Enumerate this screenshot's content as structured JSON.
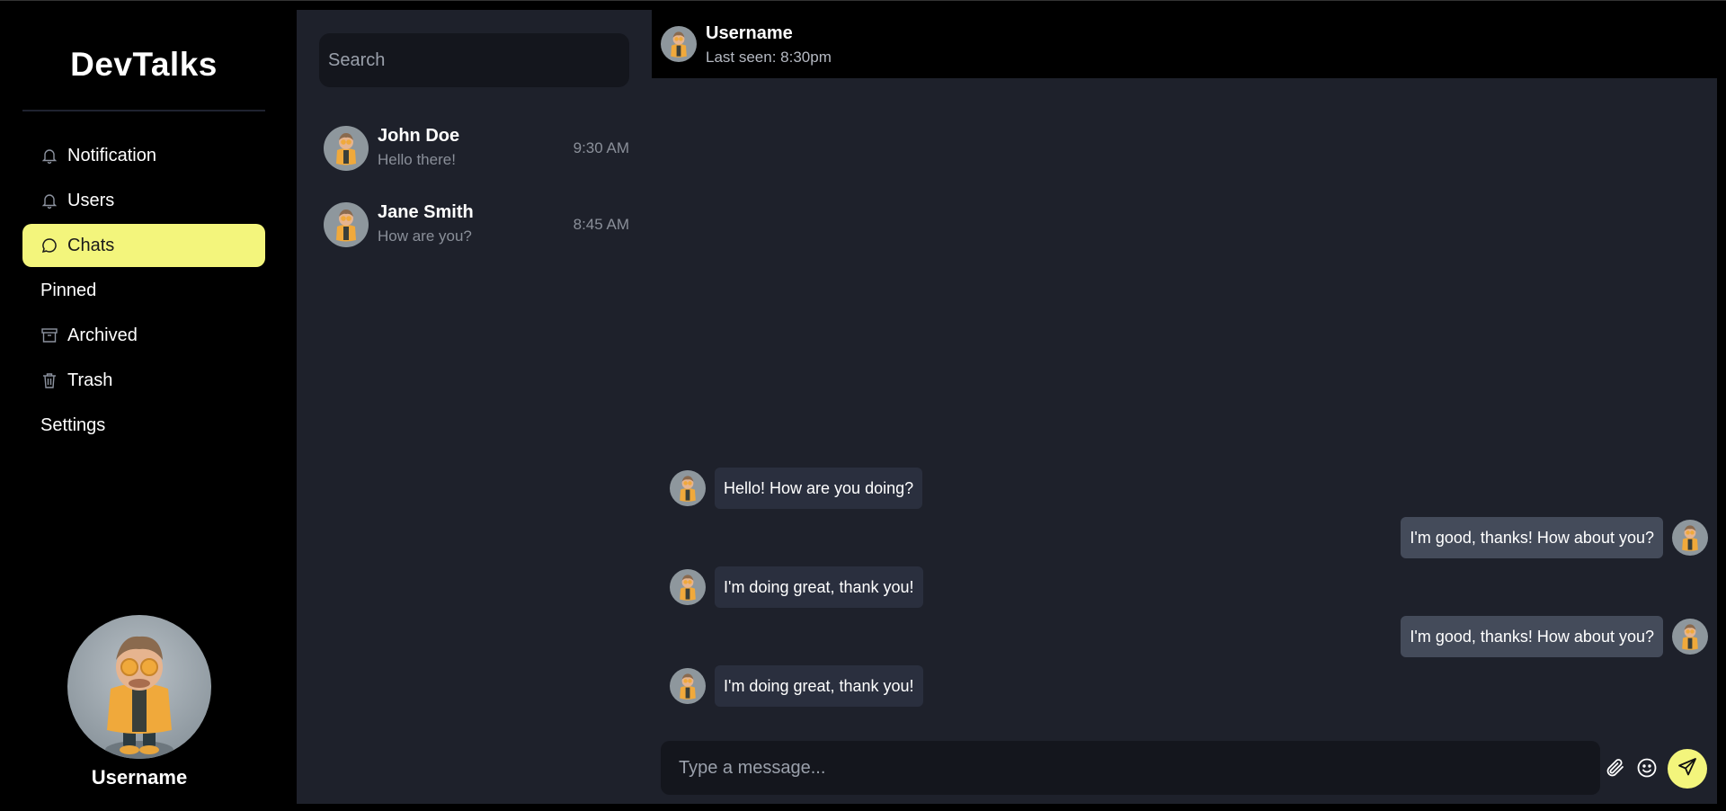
{
  "app": {
    "brand": "DevTalks",
    "accent_color": "#f3f57c"
  },
  "sidebar": {
    "items": [
      {
        "label": "Notification",
        "icon": "bell-icon",
        "active": false
      },
      {
        "label": "Users",
        "icon": "bell-icon",
        "active": false
      },
      {
        "label": "Chats",
        "icon": "chat-bubble-icon",
        "active": true
      },
      {
        "label": "Pinned",
        "icon": "",
        "active": false
      },
      {
        "label": "Archived",
        "icon": "archive-icon",
        "active": false
      },
      {
        "label": "Trash",
        "icon": "trash-icon",
        "active": false
      },
      {
        "label": "Settings",
        "icon": "",
        "active": false
      }
    ],
    "profile": {
      "name": "Username",
      "avatar": "character-avatar"
    }
  },
  "chat_list": {
    "search_placeholder": "Search",
    "search_value": "",
    "conversations": [
      {
        "name": "John Doe",
        "preview": "Hello there!",
        "time": "9:30 AM"
      },
      {
        "name": "Jane Smith",
        "preview": "How are you?",
        "time": "8:45 AM"
      }
    ]
  },
  "chat": {
    "header": {
      "title": "Username",
      "subtitle": "Last seen: 8:30pm"
    },
    "messages": [
      {
        "text": "Hello! How are you doing?",
        "direction": "incoming"
      },
      {
        "text": "I'm good, thanks! How about you?",
        "direction": "outgoing"
      },
      {
        "text": "I'm doing great, thank you!",
        "direction": "incoming"
      },
      {
        "text": "I'm good, thanks! How about you?",
        "direction": "outgoing"
      },
      {
        "text": "I'm doing great, thank you!",
        "direction": "incoming"
      }
    ],
    "composer": {
      "placeholder": "Type a message...",
      "value": ""
    },
    "tools": [
      "paperclip-icon",
      "smiley-icon",
      "send-icon"
    ]
  }
}
